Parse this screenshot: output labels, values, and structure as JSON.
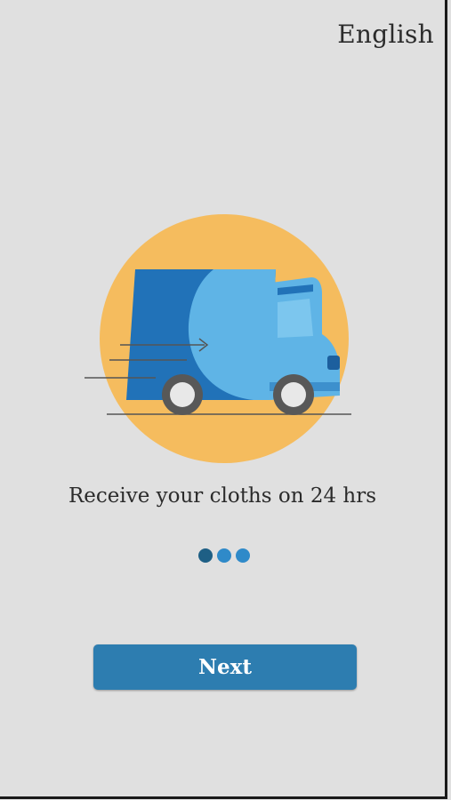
{
  "header": {
    "language_label": "English"
  },
  "slide": {
    "caption": "Receive your cloths on 24 hrs",
    "icon": "delivery-truck-icon",
    "page_count": 3,
    "active_index": 0
  },
  "footer": {
    "next_label": "Next"
  },
  "colors": {
    "background": "#e0e0e0",
    "circle": "#f5bc5e",
    "truck_dark": "#2172b8",
    "truck_light": "#5fb4e6",
    "button": "#2d7db0",
    "dot_active": "#1e5f85",
    "dot_inactive": "#2f8ac9"
  }
}
